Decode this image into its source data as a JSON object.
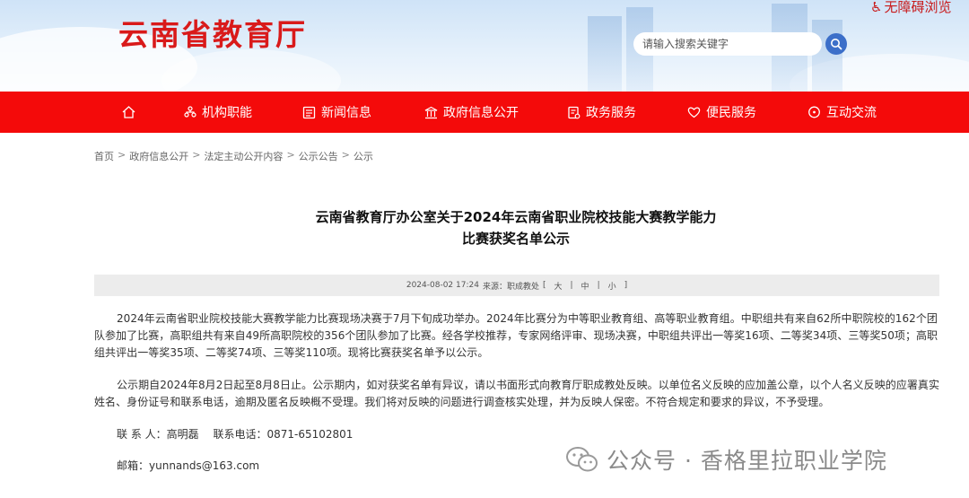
{
  "header": {
    "site_title": "云南省教育厅",
    "accessibility": "无障碍浏览",
    "search_placeholder": "请输入搜索关键字"
  },
  "nav": {
    "items": [
      {
        "label": "",
        "icon": "home-icon"
      },
      {
        "label": "机构职能",
        "icon": "org-icon"
      },
      {
        "label": "新闻信息",
        "icon": "news-icon"
      },
      {
        "label": "政府信息公开",
        "icon": "government-icon"
      },
      {
        "label": "政务服务",
        "icon": "service-icon"
      },
      {
        "label": "便民服务",
        "icon": "heart-icon"
      },
      {
        "label": "互动交流",
        "icon": "chat-icon"
      }
    ]
  },
  "breadcrumb": [
    "首页",
    "政府信息公开",
    "法定主动公开内容",
    "公示公告",
    "公示"
  ],
  "article": {
    "title_line1": "云南省教育厅办公室关于2024年云南省职业院校技能大赛教学能力",
    "title_line2": "比赛获奖名单公示",
    "meta_date": "2024-08-02 17:24",
    "meta_source": "来源：职成教处",
    "font_size_options": [
      "大",
      "中",
      "小"
    ],
    "paragraph1": "2024年云南省职业院校技能大赛教学能力比赛现场决赛于7月下旬成功举办。2024年比赛分为中等职业教育组、高等职业教育组。中职组共有来自62所中职院校的162个团队参加了比赛，高职组共有来自49所高职院校的356个团队参加了比赛。经各学校推荐，专家网络评审、现场决赛，中职组共评出一等奖16项、二等奖34项、三等奖50项；高职组共评出一等奖35项、二等奖74项、三等奖110项。现将比赛获奖名单予以公示。",
    "paragraph2": "公示期自2024年8月2日起至8月8日止。公示期内，如对获奖名单有异议，请以书面形式向教育厅职成教处反映。以单位名义反映的应加盖公章，以个人名义反映的应署真实姓名、身份证号和联系电话，逾期及匿名反映概不受理。我们将对反映的问题进行调查核实处理，并为反映人保密。不符合规定和要求的异议，不予受理。",
    "contact_person": "联 系 人：高明磊　 联系电话：0871-65102801",
    "email": "邮箱：yunnands@163.com"
  },
  "watermark": {
    "text": "公众号 · 香格里拉职业学院",
    "icon": "wechat-icon"
  },
  "colors": {
    "brand_red": "#f40a0a",
    "title_red": "#d91a1a",
    "search_blue": "#3c6fc9"
  }
}
